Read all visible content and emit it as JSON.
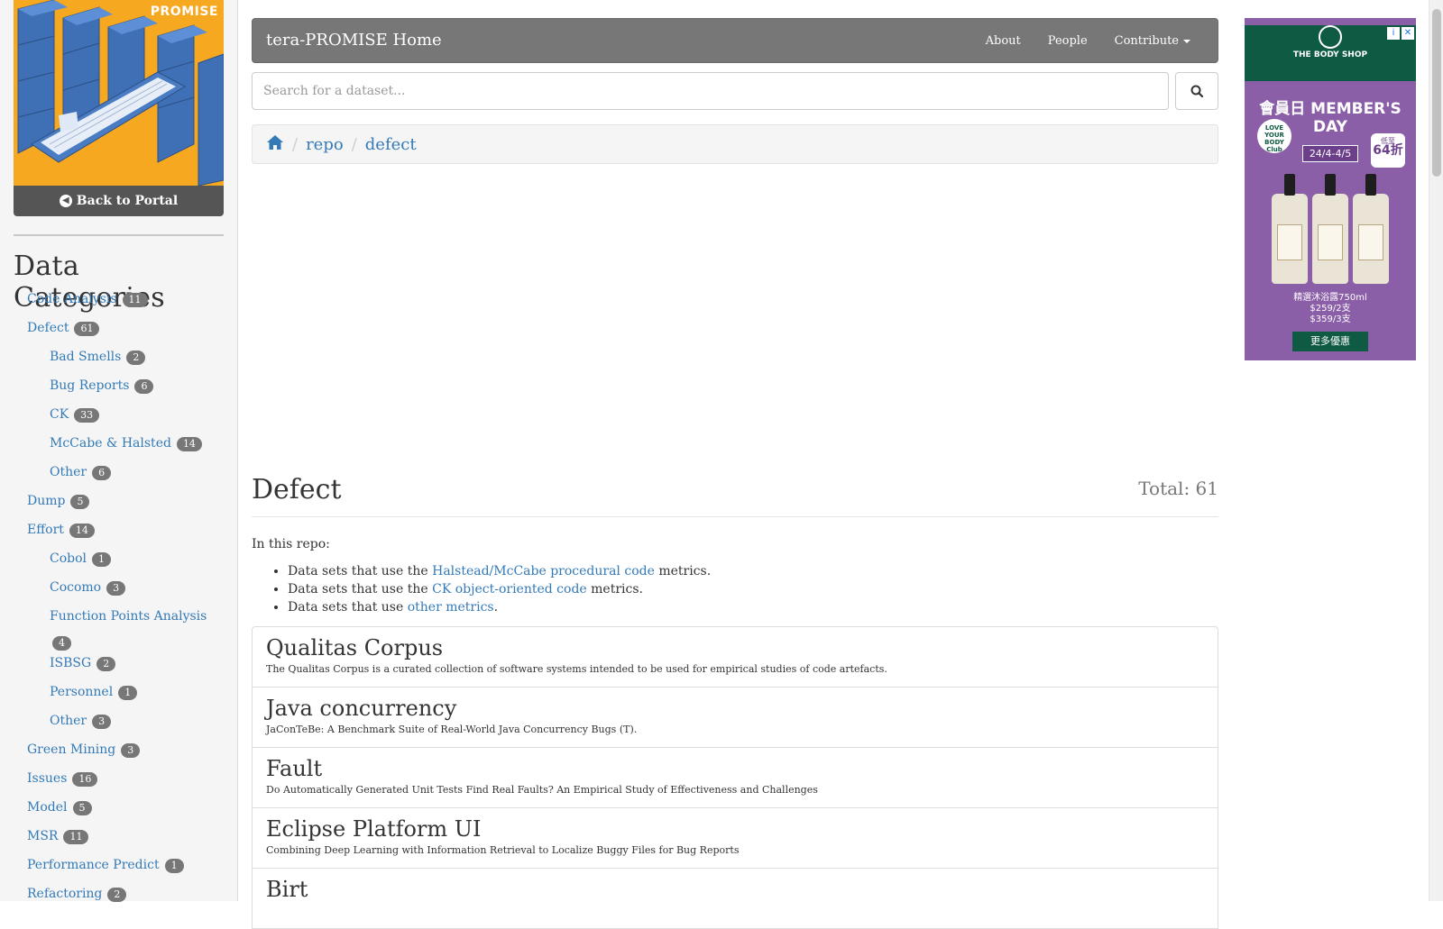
{
  "sidebar": {
    "banner_label": "PROMISE",
    "back_label": "Back to Portal",
    "categories_title": "Data Categories",
    "categories": [
      {
        "label": "Code Analysis",
        "count": "11",
        "level": 1
      },
      {
        "label": "Defect",
        "count": "61",
        "level": 1
      },
      {
        "label": "Bad Smells",
        "count": "2",
        "level": 2
      },
      {
        "label": "Bug Reports",
        "count": "6",
        "level": 2
      },
      {
        "label": "CK",
        "count": "33",
        "level": 2
      },
      {
        "label": "McCabe & Halsted",
        "count": "14",
        "level": 2
      },
      {
        "label": "Other",
        "count": "6",
        "level": 2
      },
      {
        "label": "Dump",
        "count": "5",
        "level": 1
      },
      {
        "label": "Effort",
        "count": "14",
        "level": 1
      },
      {
        "label": "Cobol",
        "count": "1",
        "level": 2
      },
      {
        "label": "Cocomo",
        "count": "3",
        "level": 2
      },
      {
        "label": "Function Points Analysis",
        "count": "4",
        "level": 2
      },
      {
        "label": "ISBSG",
        "count": "2",
        "level": 2
      },
      {
        "label": "Personnel",
        "count": "1",
        "level": 2
      },
      {
        "label": "Other",
        "count": "3",
        "level": 2
      },
      {
        "label": "Green Mining",
        "count": "3",
        "level": 1
      },
      {
        "label": "Issues",
        "count": "16",
        "level": 1
      },
      {
        "label": "Model",
        "count": "5",
        "level": 1
      },
      {
        "label": "MSR",
        "count": "11",
        "level": 1
      },
      {
        "label": "Performance Predict",
        "count": "1",
        "level": 1
      },
      {
        "label": "Refactoring",
        "count": "2",
        "level": 1
      }
    ]
  },
  "navbar": {
    "brand": "tera-PROMISE Home",
    "links": [
      "About",
      "People",
      "Contribute"
    ]
  },
  "search": {
    "placeholder": "Search for a dataset..."
  },
  "breadcrumb": {
    "items": [
      "repo",
      "defect"
    ]
  },
  "main": {
    "title": "Defect",
    "total": "Total: 61",
    "intro": "In this repo:",
    "metrics": [
      {
        "pre": "Data sets that use the ",
        "link": "Halstead/McCabe procedural code",
        "post": " metrics."
      },
      {
        "pre": "Data sets that use the ",
        "link": "CK object-oriented code",
        "post": " metrics."
      },
      {
        "pre": "Data sets that use ",
        "link": "other metrics",
        "post": "."
      }
    ],
    "datasets": [
      {
        "title": "Qualitas Corpus",
        "desc": "The Qualitas Corpus is a curated collection of software systems intended to be used for empirical studies of code artefacts."
      },
      {
        "title": "Java concurrency",
        "desc": "JaConTeBe: A Benchmark Suite of Real-World Java Concurrency Bugs (T)."
      },
      {
        "title": "Fault",
        "desc": "Do Automatically Generated Unit Tests Find Real Faults? An Empirical Study of Effectiveness and Challenges"
      },
      {
        "title": "Eclipse Platform UI",
        "desc": "Combining Deep Learning with Information Retrieval to Localize Buggy Files for Bug Reports"
      },
      {
        "title": "Birt",
        "desc": ""
      }
    ]
  },
  "ad": {
    "brand": "THE BODY SHOP",
    "headline": "會員日 MEMBER'S DAY",
    "date": "24/4-4/5",
    "badge": "LOVE YOUR BODY Club",
    "discount_top": "低至",
    "discount_value": "64折",
    "price_line1": "精選沐浴露750ml",
    "price_line2": "$259/2支",
    "price_line3": "$359/3支",
    "cta": "更多優惠",
    "close_info": "i",
    "close_x": "✕"
  }
}
